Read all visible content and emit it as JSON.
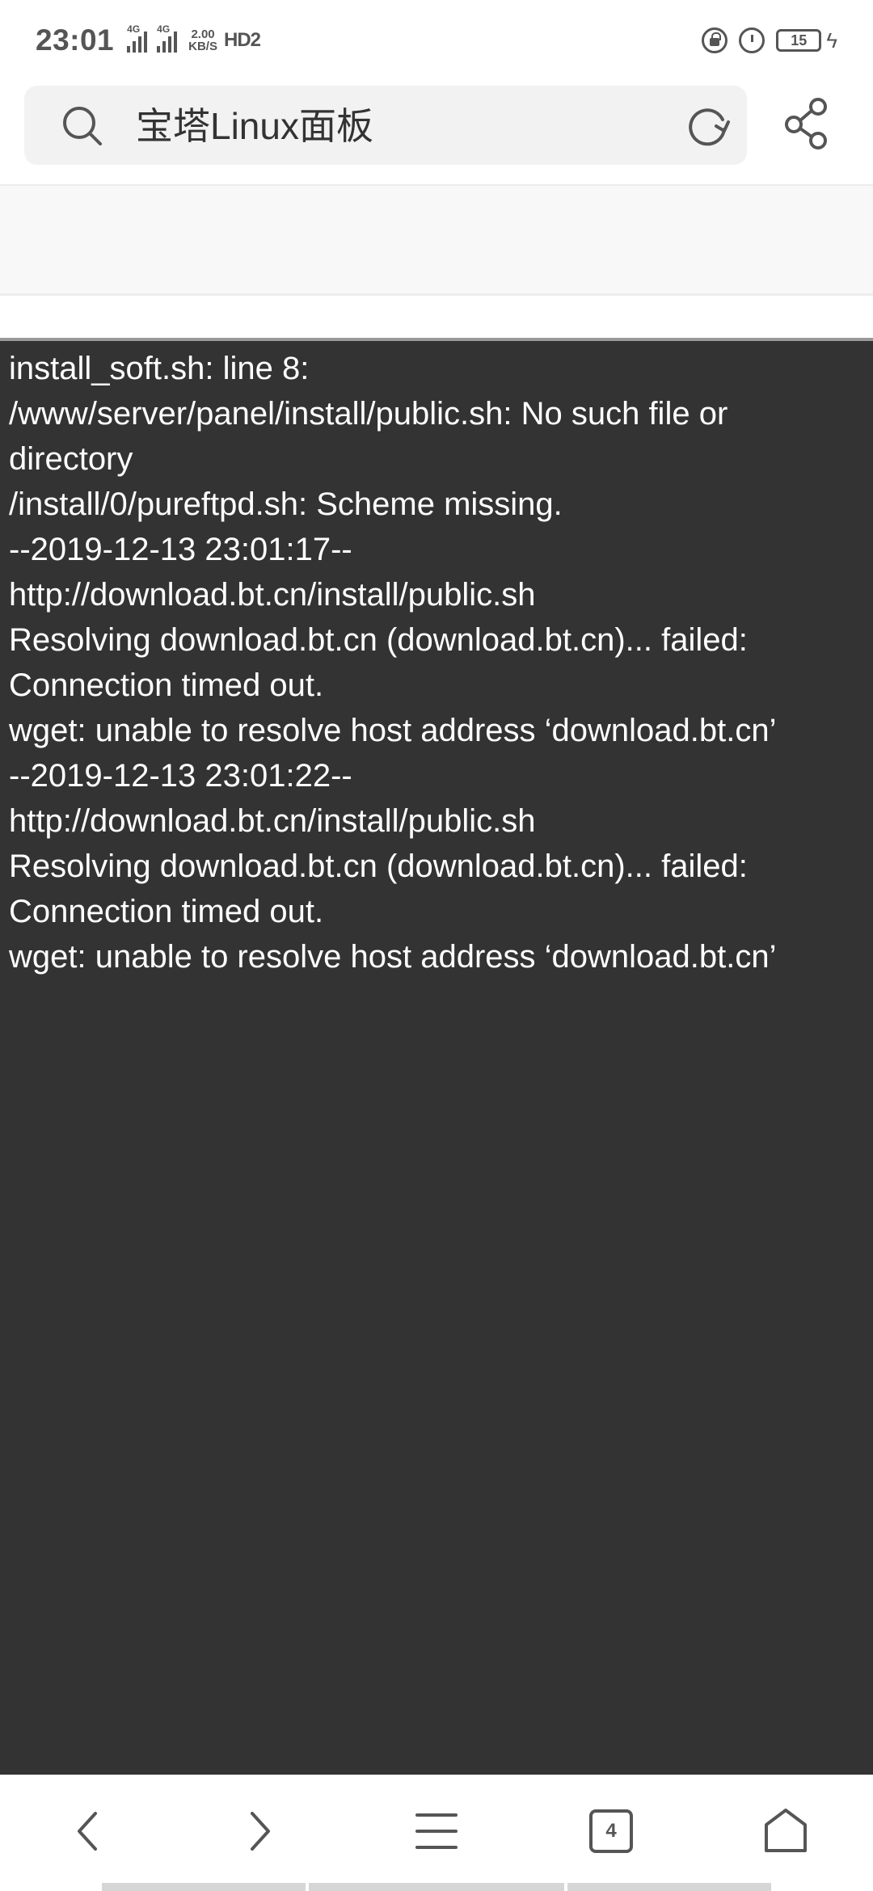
{
  "status_bar": {
    "time": "23:01",
    "signal_1_label": "4G",
    "signal_2_label": "4G",
    "network_speed_value": "2.00",
    "network_speed_unit": "KB/S",
    "hd_label": "HD2",
    "battery_level": "15"
  },
  "address_bar": {
    "query": "宝塔Linux面板"
  },
  "terminal": {
    "lines": [
      "install_soft.sh: line 8:",
      "/www/server/panel/install/public.sh: No such file or",
      "directory",
      "/install/0/pureftpd.sh: Scheme missing.",
      "--2019-12-13 23:01:17--",
      "http://download.bt.cn/install/public.sh",
      "Resolving download.bt.cn (download.bt.cn)... failed:",
      "Connection timed out.",
      "wget: unable to resolve host address ‘download.bt.cn’",
      "--2019-12-13 23:01:22--",
      "http://download.bt.cn/install/public.sh",
      "Resolving download.bt.cn (download.bt.cn)... failed:",
      "Connection timed out.",
      "wget: unable to resolve host address ‘download.bt.cn’"
    ]
  },
  "bottom_nav": {
    "tab_count": "4"
  },
  "colors": {
    "terminal_background": "#333333",
    "terminal_text": "#ffffff",
    "icon_gray": "#555555",
    "search_box": "#f2f2f2"
  }
}
